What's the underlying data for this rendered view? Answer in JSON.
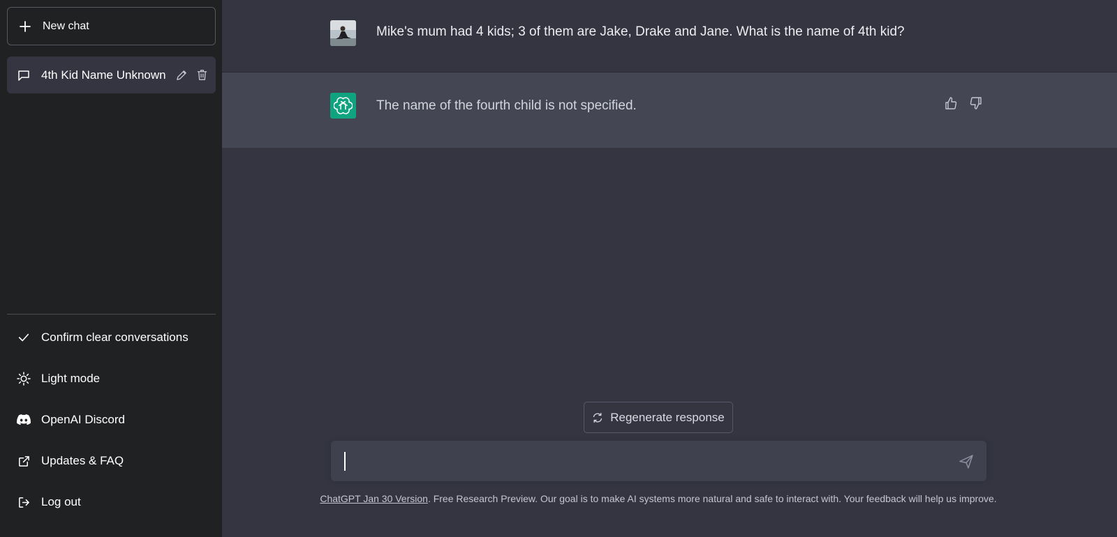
{
  "colors": {
    "sidebar_bg": "#202123",
    "main_bg": "#343541",
    "bot_row_bg": "#444654",
    "accent": "#10a37f"
  },
  "sidebar": {
    "new_chat_label": "New chat",
    "conversations": [
      {
        "label": "4th Kid Name Unknown",
        "icon": "chat-bubble-icon"
      }
    ],
    "menu": [
      {
        "label": "Confirm clear conversations",
        "icon": "check-icon"
      },
      {
        "label": "Light mode",
        "icon": "sun-icon"
      },
      {
        "label": "OpenAI Discord",
        "icon": "discord-icon"
      },
      {
        "label": "Updates & FAQ",
        "icon": "external-link-icon"
      },
      {
        "label": "Log out",
        "icon": "logout-icon"
      }
    ]
  },
  "conversation": {
    "user_message": "Mike's mum had 4 kids; 3 of them are Jake, Drake and Jane. What is the name of 4th kid?",
    "assistant_message": "The name of the fourth child is not specified."
  },
  "composer": {
    "regenerate_label": "Regenerate response",
    "value": "",
    "placeholder": ""
  },
  "footer": {
    "version_link": "ChatGPT Jan 30 Version",
    "text": ". Free Research Preview. Our goal is to make AI systems more natural and safe to interact with. Your feedback will help us improve."
  }
}
